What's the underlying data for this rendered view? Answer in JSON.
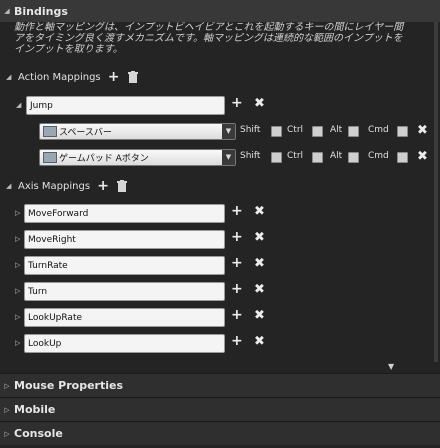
{
  "bindings": {
    "header": "Bindings",
    "description_lines": [
      "動作と軸マッピングは、インプットビヘイビアとこれを起動するキーの間にレイヤー間",
      "アをタイミング良く渡すメカニズムです。軸マッピングは連続的な範囲のインプットを",
      "インプットを取ります。"
    ]
  },
  "action_mappings": {
    "label": "Action Mappings",
    "items": [
      {
        "name": "Jump",
        "keys": [
          {
            "key": "スペースバー",
            "modifiers": [
              "Shift",
              "Ctrl",
              "Alt",
              "Cmd"
            ]
          },
          {
            "key": "ゲームパッド Aボタン",
            "modifiers": [
              "Shift",
              "Ctrl",
              "Alt",
              "Cmd"
            ]
          }
        ]
      }
    ]
  },
  "axis_mappings": {
    "label": "Axis Mappings",
    "items": [
      "MoveForward",
      "MoveRight",
      "TurnRate",
      "Turn",
      "LookUpRate",
      "LookUp"
    ]
  },
  "sections": [
    {
      "label": "Mouse Properties"
    },
    {
      "label": "Mobile"
    },
    {
      "label": "Console"
    }
  ],
  "icons": {
    "plus": "+",
    "remove": "✖",
    "expanded": "◢",
    "collapsed": "▷",
    "dropdown": "▼"
  }
}
